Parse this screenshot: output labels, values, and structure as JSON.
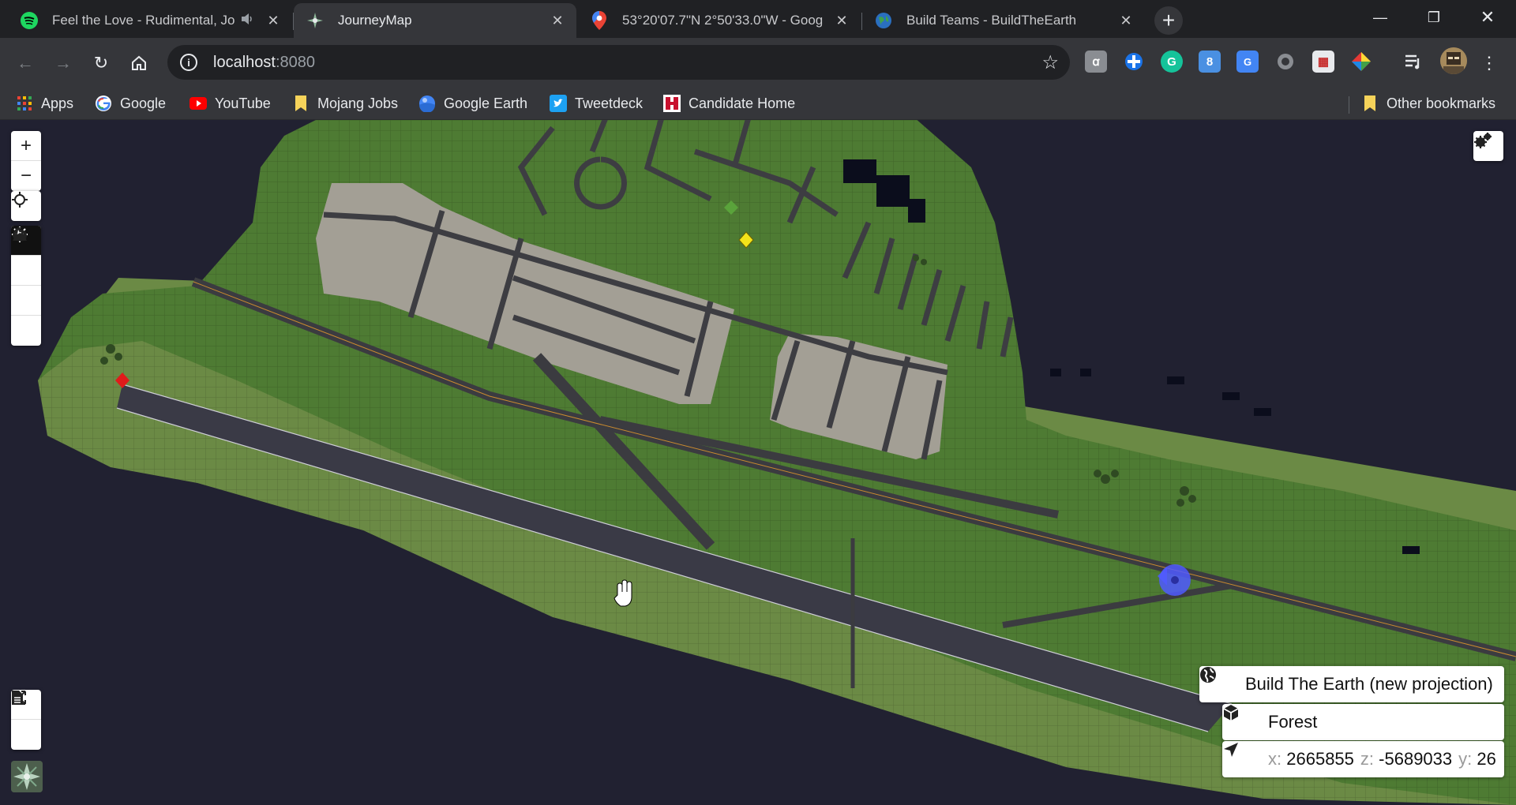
{
  "tabs": [
    {
      "title": "Feel the Love - Rudimental, Jo",
      "icon": "spotify-icon",
      "audio": true,
      "active": false
    },
    {
      "title": "JourneyMap",
      "icon": "journeymap-icon",
      "active": true
    },
    {
      "title": "53°20'07.7\"N 2°50'33.0\"W - Goog",
      "icon": "google-maps-icon",
      "active": false
    },
    {
      "title": "Build Teams - BuildTheEarth",
      "icon": "buildtheearth-icon",
      "active": false
    }
  ],
  "address": {
    "host": "localhost",
    "port": ":8080"
  },
  "bookmarks": [
    {
      "label": "Apps",
      "icon": "apps-grid-icon"
    },
    {
      "label": "Google",
      "icon": "google-icon"
    },
    {
      "label": "YouTube",
      "icon": "youtube-icon"
    },
    {
      "label": "Mojang Jobs",
      "icon": "folder-icon"
    },
    {
      "label": "Google Earth",
      "icon": "google-earth-icon"
    },
    {
      "label": "Tweetdeck",
      "icon": "twitter-icon"
    },
    {
      "label": "Candidate Home",
      "icon": "candidate-icon"
    }
  ],
  "other_bookmarks": "Other bookmarks",
  "map": {
    "controls": {
      "zoom_in": "+",
      "zoom_out": "−",
      "modes": [
        {
          "name": "day-mode",
          "icon": "sun-icon",
          "active": true
        },
        {
          "name": "night-mode",
          "icon": "moon-icon",
          "active": false
        },
        {
          "name": "cave-mode",
          "icon": "cave-icon",
          "active": false
        },
        {
          "name": "topo-mode",
          "icon": "mountain-icon",
          "active": false
        }
      ]
    },
    "world": "Build The Earth (new projection)",
    "biome": "Forest",
    "coords": {
      "x_label": "x:",
      "x": "2665855",
      "z_label": "z:",
      "z": "-5689033",
      "y_label": "y:",
      "y": "26"
    }
  }
}
